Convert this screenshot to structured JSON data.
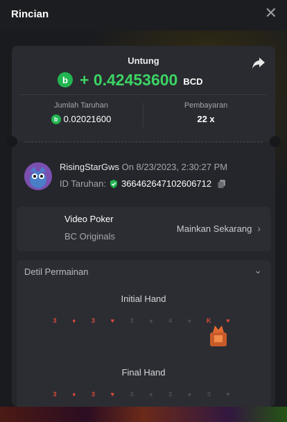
{
  "header": {
    "title": "Rincian",
    "close_glyph": "✕"
  },
  "result": {
    "profit_label": "Untung",
    "profit_value": "+ 0.42453600",
    "currency": "BCD",
    "coin_glyph": "b",
    "bet_amount_label": "Jumlah Taruhan",
    "bet_amount": "0.02021600",
    "payout_label": "Pembayaran",
    "payout": "22 x"
  },
  "player": {
    "name": "RisingStarGws",
    "time": "On 8/23/2023, 2:30:27 PM",
    "bet_id_label": "ID Taruhan:",
    "bet_id": "366462647102606712"
  },
  "game": {
    "name": "Video Poker",
    "provider": "BC Originals",
    "play_label": "Mainkan Sekarang"
  },
  "details": {
    "title": "Detil Permainan",
    "initial_hand_title": "Initial Hand",
    "final_hand_title": "Final Hand",
    "initial_cards": [
      "3",
      "♦",
      "3",
      "♥",
      "3",
      "♠",
      "4",
      "♠",
      "K",
      "♥"
    ],
    "final_cards": [
      "3",
      "♦",
      "3",
      "♥",
      "3",
      "♠",
      "3",
      "♠",
      "3",
      "♥"
    ]
  },
  "colors": {
    "accent_green": "#3bd464",
    "card_red": "#e04a3d",
    "panel": "#2c2d32"
  },
  "icons": [
    "close-icon",
    "share-icon",
    "coin-icon",
    "verified-shield-icon",
    "copy-icon",
    "chevron-right-icon",
    "chevron-down-icon",
    "crown-icon"
  ]
}
